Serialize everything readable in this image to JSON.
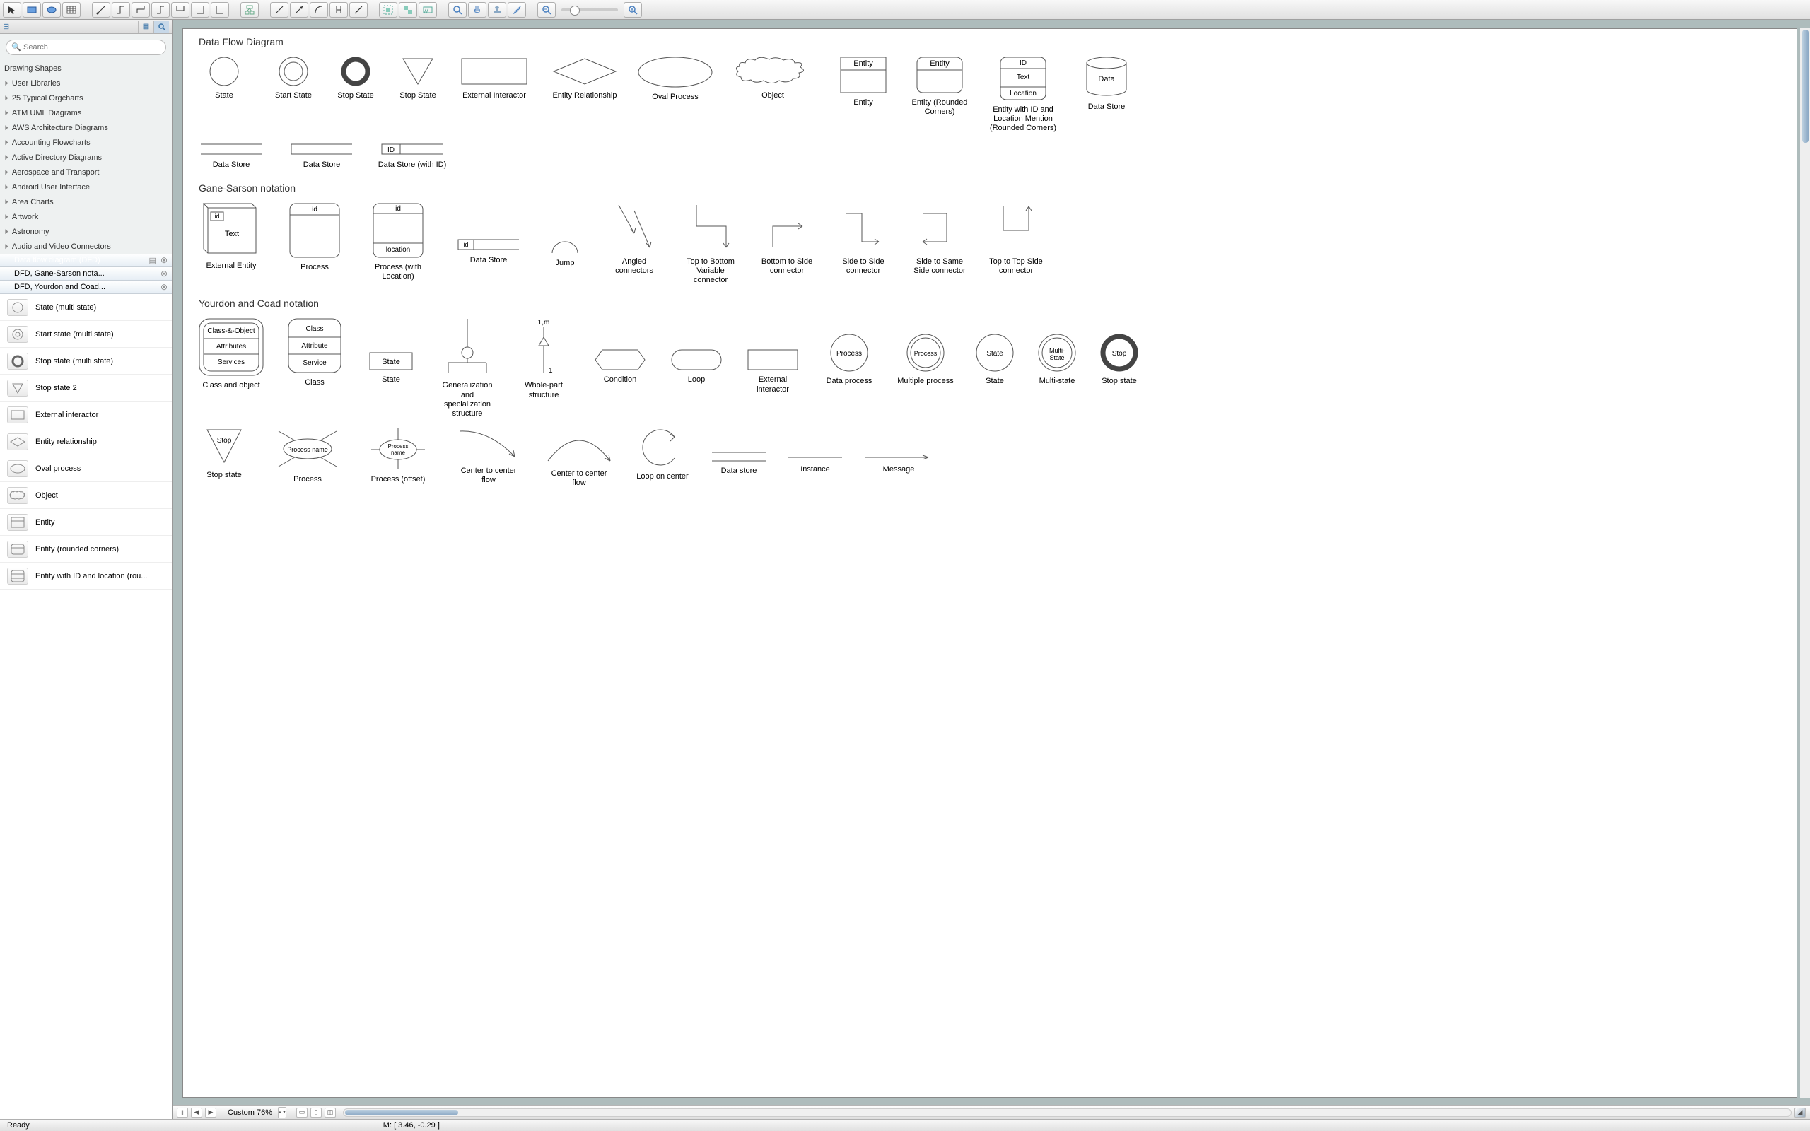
{
  "search": {
    "placeholder": "Search"
  },
  "status": {
    "ready": "Ready",
    "mouse": "M: [ 3.46, -0.29 ]"
  },
  "zoom": "Custom 76%",
  "categories": [
    "Drawing Shapes",
    "User Libraries",
    "25 Typical Orgcharts",
    "ATM UML Diagrams",
    "AWS Architecture Diagrams",
    "Accounting Flowcharts",
    "Active Directory Diagrams",
    "Aerospace and Transport",
    "Android User Interface",
    "Area Charts",
    "Artwork",
    "Astronomy",
    "Audio and Video Connectors"
  ],
  "subtabs": [
    "Data flow diagram (DFD)",
    "DFD, Gane-Sarson nota...",
    "DFD, Yourdon and Coad..."
  ],
  "shapelist": [
    "State (multi state)",
    "Start state (multi state)",
    "Stop state (multi state)",
    "Stop state 2",
    "External interactor",
    "Entity relationship",
    "Oval process",
    "Object",
    "Entity",
    "Entity (rounded corners)",
    "Entity with ID and location (rou..."
  ],
  "section1": {
    "title": "Data Flow Diagram",
    "shapes": [
      "State",
      "Start State",
      "Stop State",
      "Stop State",
      "External Interactor",
      "Entity Relationship",
      "Oval Process",
      "Object",
      "Entity",
      "Entity (Rounded Corners)",
      "Entity with ID and Location Mention (Rounded Corners)",
      "Data Store"
    ],
    "entitybox": {
      "t": "Entity"
    },
    "entity_id": {
      "id": "ID",
      "text": "Text",
      "loc": "Location"
    },
    "datastore": {
      "t": "Data"
    },
    "row2": [
      "Data Store",
      "Data Store",
      "Data Store (with ID)"
    ],
    "dsid": "ID"
  },
  "section2": {
    "title": "Gane-Sarson notation",
    "shapes": [
      "External Entity",
      "Process",
      "Process (with Location)",
      "Data Store",
      "Jump",
      "Angled connectors",
      "Top to Bottom Variable connector",
      "Bottom to Side connector",
      "Side to Side connector",
      "Side to Same Side connector",
      "Top to Top Side connector"
    ],
    "ext": {
      "id": "id",
      "text": "Text"
    },
    "proc": {
      "id": "id"
    },
    "procloc": {
      "id": "id",
      "loc": "location"
    },
    "dsid": "id"
  },
  "section3": {
    "title": "Yourdon and Coad notation",
    "shapes": [
      "Class and object",
      "Class",
      "State",
      "Generalization and specialization structure",
      "Whole-part structure",
      "Condition",
      "Loop",
      "External interactor",
      "Data process",
      "Multiple process",
      "State",
      "Multi-state",
      "Stop state"
    ],
    "cao": {
      "t": "Class-&-Object",
      "a": "Attributes",
      "s": "Services"
    },
    "cls": {
      "t": "Class",
      "a": "Attribute",
      "s": "Service"
    },
    "state": "State",
    "wp": {
      "top": "1,m",
      "bot": "1"
    },
    "dp": "Process",
    "mp": "Process",
    "st": "State",
    "ms": "Multi-State",
    "stop": "Stop",
    "row2": [
      "Stop state",
      "Process",
      "Process (offset)",
      "Center to center flow",
      "Center to center flow",
      "Loop on center",
      "Data store",
      "Instance",
      "Message"
    ],
    "row2_stop": "Stop",
    "row2_proc": "Process name",
    "row2_procoff": "Process name"
  }
}
